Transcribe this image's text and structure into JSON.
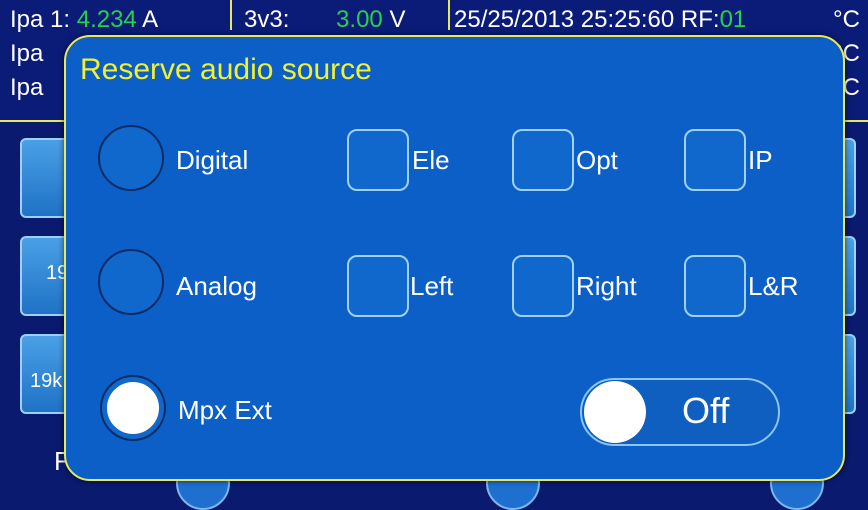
{
  "status": {
    "row1_label": "Ipa 1:",
    "row1_value": "4.234",
    "row1_unit": "A",
    "row2_label": "Ipa",
    "row3_label": "Ipa",
    "v_label": "3v3:",
    "v_value": "3.00",
    "v_unit": "V",
    "datetime": "25/25/2013 25:25:60",
    "rf_label": "RF:",
    "rf_value": "01",
    "temp_unit1": "°C",
    "temp_unit2": "°C",
    "temp_unit3": "°C"
  },
  "background": {
    "btn2_text": "19",
    "btn3_text": "19k",
    "bottom_text": "F"
  },
  "dialog": {
    "title": "Reserve audio source",
    "radios": [
      {
        "label": "Digital",
        "selected": false
      },
      {
        "label": "Analog",
        "selected": false
      },
      {
        "label": "Mpx Ext",
        "selected": true
      }
    ],
    "checks_row1": [
      {
        "label": "Ele",
        "checked": false
      },
      {
        "label": "Opt",
        "checked": false
      },
      {
        "label": "IP",
        "checked": false
      }
    ],
    "checks_row2": [
      {
        "label": "Left",
        "checked": false
      },
      {
        "label": "Right",
        "checked": false
      },
      {
        "label": "L&R",
        "checked": false
      }
    ],
    "toggle_label": "Off"
  },
  "colors": {
    "dialog_bg": "#0b5fc6",
    "title": "#f2f030",
    "status_value": "#29d04a",
    "divider": "#e8e860"
  }
}
